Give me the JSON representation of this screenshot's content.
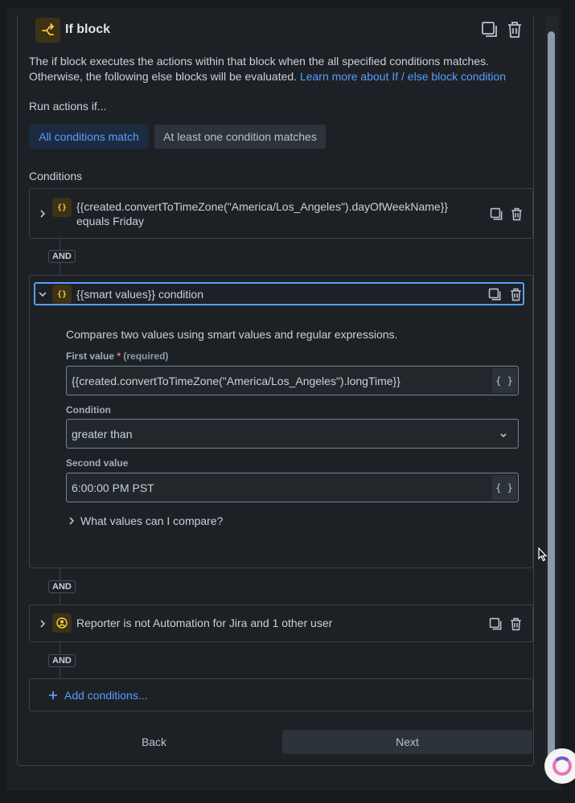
{
  "block": {
    "title": "If block",
    "description": "The if block executes the actions within that block when the all specified conditions matches. Otherwise, the following else blocks will be evaluated.",
    "learn_more": "Learn more about If / else block condition",
    "run_label": "Run actions if...",
    "run_options": [
      "All conditions match",
      "At least one condition matches"
    ],
    "selected_run_option": "All conditions match",
    "conditions_label": "Conditions"
  },
  "conditions": [
    {
      "icon": "braces-icon",
      "text": "{{created.convertToTimeZone(\"America/Los_Angeles\").dayOfWeekName}} equals Friday",
      "expanded": false
    },
    {
      "icon": "braces-icon",
      "text": "{{smart values}} condition",
      "expanded": true,
      "detail": {
        "description": "Compares two values using smart values and regular expressions.",
        "first_value_label": "First value",
        "required_marker": "*",
        "required_text": "(required)",
        "first_value": "{{created.convertToTimeZone(\"America/Los_Angeles\").longTime}}",
        "condition_label": "Condition",
        "condition_value": "greater than",
        "second_value_label": "Second value",
        "second_value": "6:00:00 PM PST",
        "help_toggle": "What values can I compare?"
      }
    },
    {
      "icon": "user-circle-icon",
      "text": "Reporter is not Automation for Jira and 1 other user",
      "expanded": false
    }
  ],
  "and_label": "AND",
  "brace_glyph": "{ }",
  "add_conditions": "Add conditions...",
  "buttons": {
    "back": "Back",
    "next": "Next"
  },
  "colors": {
    "accent": "#579dff",
    "icon_bg": "#3d3116",
    "icon_fg": "#f5cd47",
    "required": "#f87168"
  }
}
